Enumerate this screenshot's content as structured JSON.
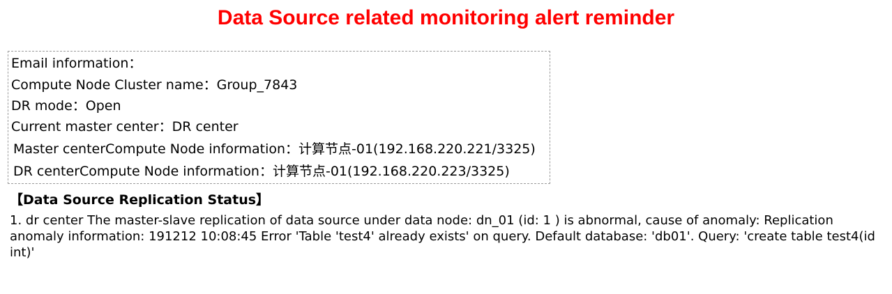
{
  "title": "Data Source related monitoring alert reminder",
  "info": {
    "email_info": "Email information：",
    "cluster_name": "Compute Node Cluster name：Group_7843",
    "dr_mode": "DR mode：Open",
    "current_master": "Current master center：DR center",
    "master_center_node": "Master centerCompute Node information：计算节点-01(192.168.220.221/3325)",
    "dr_center_node": "DR centerCompute Node information：计算节点-01(192.168.220.223/3325)"
  },
  "section": {
    "heading": "【Data Source Replication Status】",
    "body": "1. dr center The master-slave replication of data source under data node: dn_01 (id: 1 ) is abnormal, cause of anomaly: Replication anomaly information: 191212 10:08:45 Error 'Table 'test4' already exists' on query. Default database: 'db01'. Query: 'create table test4(id int)'"
  },
  "colors": {
    "title": "#ff0000",
    "box_border": "#9a9a9a",
    "text": "#000000"
  }
}
